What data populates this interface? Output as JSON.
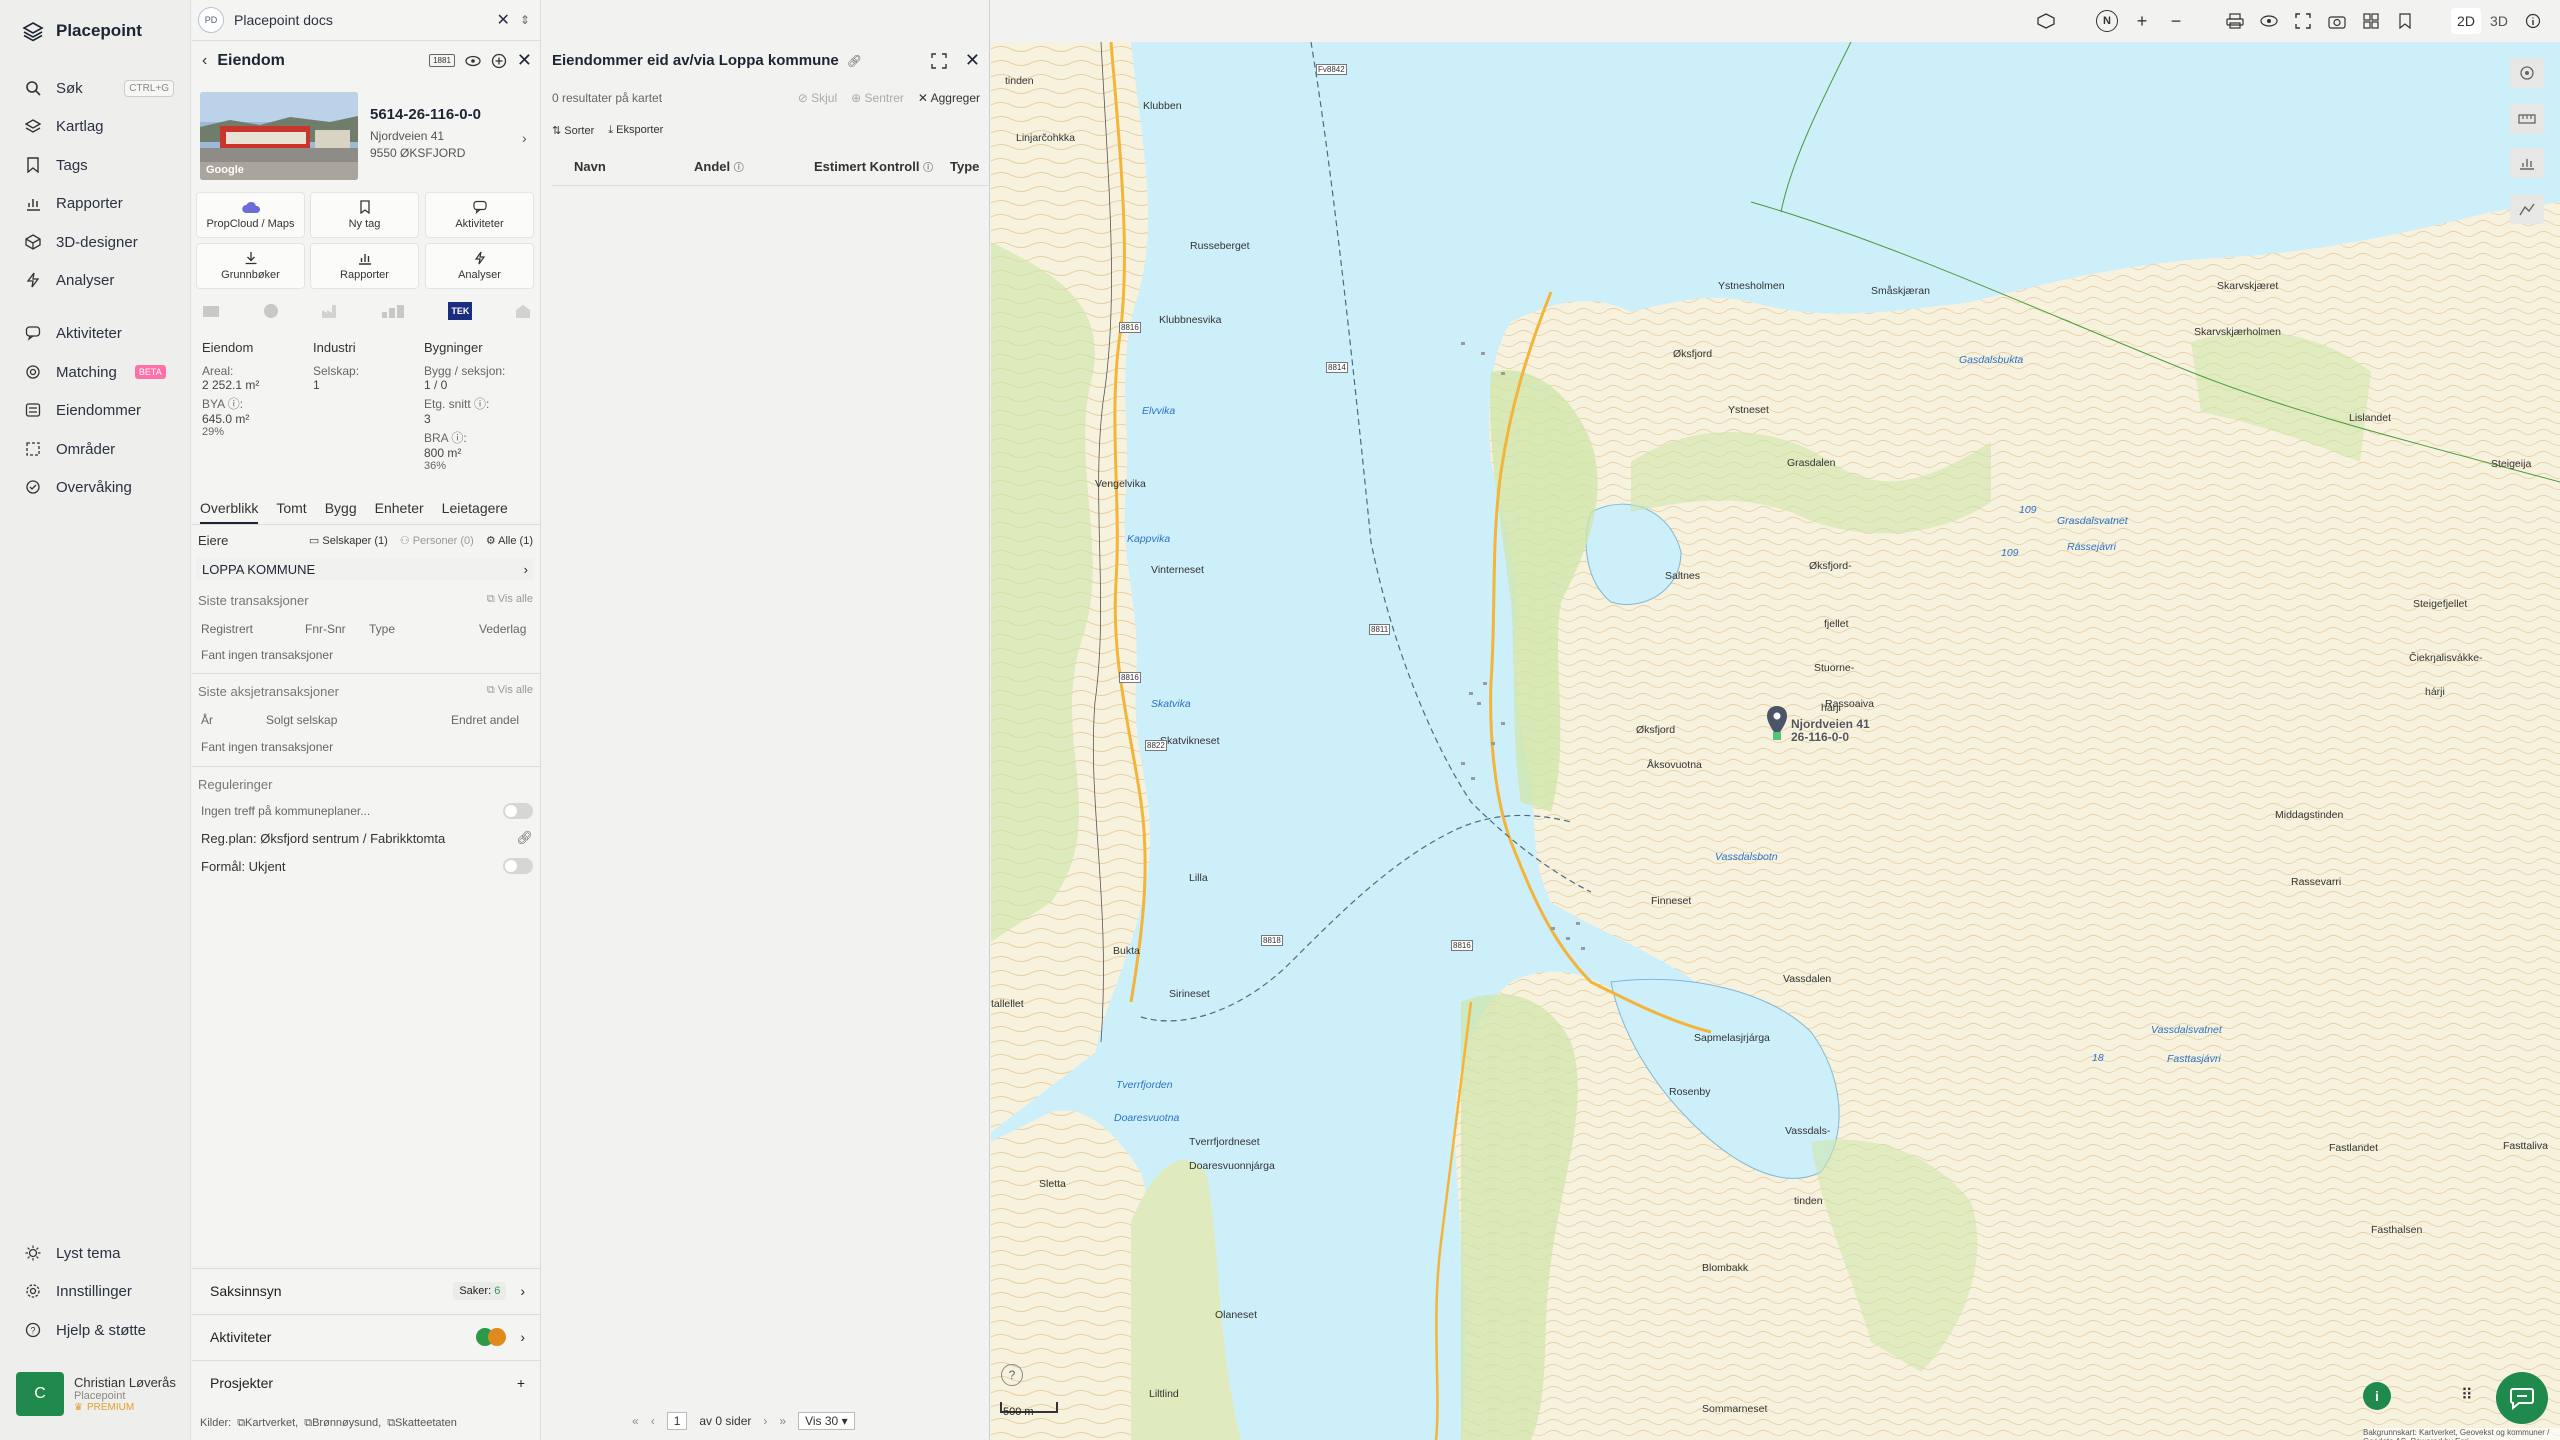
{
  "app": {
    "name": "Placepoint"
  },
  "nav": {
    "items": [
      {
        "label": "Søk",
        "shortcut": "CTRL+G"
      },
      {
        "label": "Kartlag"
      },
      {
        "label": "Tags"
      },
      {
        "label": "Rapporter"
      },
      {
        "label": "3D-designer"
      },
      {
        "label": "Analyser"
      },
      {
        "label": "Aktiviteter"
      },
      {
        "label": "Matching",
        "badge": "BETA"
      },
      {
        "label": "Eiendommer"
      },
      {
        "label": "Områder"
      },
      {
        "label": "Overvåking"
      }
    ],
    "bottom": [
      "Lyst tema",
      "Innstillinger",
      "Hjelp & støtte"
    ],
    "user": {
      "initial": "C",
      "name": "Christian Løverås",
      "org": "Placepoint",
      "plan": "PREMIUM"
    }
  },
  "docs_tab": {
    "badge": "PD",
    "title": "Placepoint docs"
  },
  "property": {
    "header": "Eiendom",
    "badge": "1881",
    "id": "5614-26-116-0-0",
    "street": "Njordveien 41",
    "postal": "9550 ØKSFJORD",
    "photo_credit": "Google",
    "tiles": [
      "PropCloud / Maps",
      "Ny tag",
      "Aktiviteter",
      "Grunnbøker",
      "Rapporter",
      "Analyser"
    ],
    "tek_badge": "TEK",
    "summary": {
      "eiendom": {
        "title": "Eiendom",
        "areal_label": "Areal:",
        "areal_value": "2 252.1 m²",
        "bya_label": "BYA ⓘ:",
        "bya_value": "645.0 m²",
        "bya_pct": "29%"
      },
      "industri": {
        "title": "Industri",
        "selskap_label": "Selskap:",
        "selskap_value": "1"
      },
      "bygninger": {
        "title": "Bygninger",
        "bygg_label": "Bygg / seksjon:",
        "bygg_value": "1 / 0",
        "etg_label": "Etg. snitt ⓘ:",
        "etg_value": "3",
        "bra_label": "BRA ⓘ:",
        "bra_value": "800 m²",
        "bra_pct": "36%"
      }
    },
    "tabs": [
      "Overblikk",
      "Tomt",
      "Bygg",
      "Enheter",
      "Leietagere"
    ],
    "owners": {
      "label": "Eiere",
      "filters": [
        "Selskaper (1)",
        "Personer (0)",
        "Alle (1)"
      ],
      "owner": "LOPPA KOMMUNE"
    },
    "transactions": {
      "title": "Siste transaksjoner",
      "view_all": "Vis alle",
      "columns": [
        "Registrert",
        "Fnr-Snr",
        "Type",
        "Vederlag"
      ],
      "empty": "Fant ingen transaksjoner"
    },
    "share_tx": {
      "title": "Siste aksjetransaksjoner",
      "view_all": "Vis alle",
      "columns": [
        "År",
        "Solgt selskap",
        "Endret andel"
      ],
      "empty": "Fant ingen transaksjoner"
    },
    "regulations": {
      "title": "Reguleringer",
      "items": [
        "Ingen treff på kommuneplaner...",
        "Reg.plan: Øksfjord sentrum / Fabrikktomta",
        "Formål: Ukjent"
      ]
    },
    "saksinnsyn": {
      "label": "Saksinnsyn",
      "count_label": "Saker:",
      "count": "6"
    },
    "aktiviteter": {
      "label": "Aktiviteter"
    },
    "prosjekter": {
      "label": "Prosjekter"
    },
    "sources": {
      "label": "Kilder:",
      "items": [
        "Kartverket,",
        "Brønnøysund,",
        "Skatteetaten"
      ]
    }
  },
  "results": {
    "title": "Eiendommer eid av/via Loppa kommune",
    "count": "0 resultater på kartet",
    "actions": [
      "Skjul",
      "Sentrer",
      "Aggreger"
    ],
    "tools": [
      "Sorter",
      "Eksporter"
    ],
    "columns": [
      "Navn",
      "Andel",
      "Estimert Kontroll",
      "Type"
    ],
    "pagination": {
      "page": "1",
      "of": "av 0 sider",
      "per_page": "Vis 30"
    }
  },
  "map": {
    "top_buttons": [
      "N",
      "+",
      "−",
      "2D",
      "3D"
    ],
    "scale": "500 m",
    "marker_label": "Njordveien 41",
    "marker_id": "26-116-0-0",
    "places": [
      "tinden",
      "Linjarčohkka",
      "Klubben",
      "Russeberget",
      "Klubbnesvika",
      "Vengelvika",
      "Vinterneset",
      "Skatvikneset",
      "Lilla",
      "Bukta",
      "Sirineset",
      "tallellet",
      "Sletta",
      "Tverrfjordneset",
      "Doaresvuonnjárga",
      "Olaneset",
      "Liltlind",
      "Ystnesholmen",
      "Småskjæran",
      "Skarvskjæret",
      "Skarvskjærholmen",
      "Lislandet",
      "Steigeija",
      "Øksfjord",
      "Ystneset",
      "Grasdalen",
      "Øksfjord-",
      "fjellet",
      "Stuorne-",
      "hárji",
      "Rassoaiva",
      "Steigefjellet",
      "Čiekŋalisvákke-",
      "hárji",
      "Saltnes",
      "Øksfjord",
      "Åksovuotna",
      "Middagstinden",
      "Finneset",
      "Vassdalen",
      "Rassevarri",
      "Sapmelasjrjárga",
      "Rosenby",
      "Vassdals-",
      "tinden",
      "Fastlandet",
      "Fasttaliva",
      "Blombakk",
      "Sommarneset",
      "Fasthalsen"
    ],
    "waters": [
      "Kappvika",
      "Elvvika",
      "Skatvika",
      "Tverrfjorden",
      "Doaresvuotna",
      "Gasdalsbukta",
      "Grasdalsvatnet",
      "Rássejávri",
      "Vassdalsbotn",
      "Vassdalsvatnet",
      "Fasttasjávri"
    ],
    "numbers": [
      "109",
      "109",
      "18"
    ],
    "roads": [
      "Fv8842",
      "8816",
      "8816",
      "8814",
      "8811",
      "8818",
      "8816",
      "8822"
    ],
    "copyright": "Bakgrunnskart: Kartverket, Geovekst og kommuner / Geodata AS. Powered by Esri"
  }
}
